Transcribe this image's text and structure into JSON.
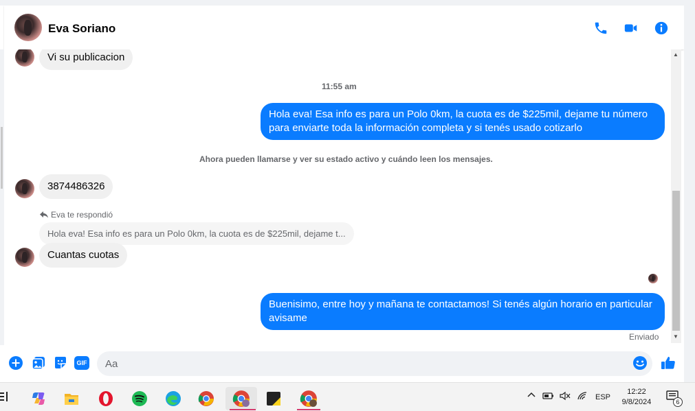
{
  "header": {
    "contact_name": "Eva Soriano"
  },
  "icons": {
    "call": "phone-icon",
    "video": "video-camera-icon",
    "info": "info-icon"
  },
  "colors": {
    "accent": "#0a7cff",
    "incoming_bubble": "#f0f0f0",
    "muted_text": "#65676b"
  },
  "messages": {
    "incoming_1": "Vi su publicacion",
    "timestamp": "11:55 am",
    "outgoing_1": "Hola eva! Esa info es para un Polo 0km, la cuota es de $225mil, dejame tu número para enviarte toda la información completa y si tenés usado cotizarlo",
    "system_notice": "Ahora pueden llamarse y ver su estado activo y cuándo leen los mensajes.",
    "incoming_2": "3874486326",
    "reply_header": "Eva te respondió",
    "reply_quote": "Hola eva! Esa info es para un Polo 0km, la cuota es de $225mil, dejame t...",
    "incoming_3": "Cuantas cuotas",
    "outgoing_2": "Buenisimo, entre hoy y mañana te contactamos! Si tenés algún horario en particular avisame",
    "status": "Enviado"
  },
  "composer": {
    "placeholder": "Aa",
    "gif_label": "GIF"
  },
  "taskbar": {
    "language": "ESP",
    "time": "12:22",
    "date": "9/8/2024",
    "notification_count": "6"
  }
}
